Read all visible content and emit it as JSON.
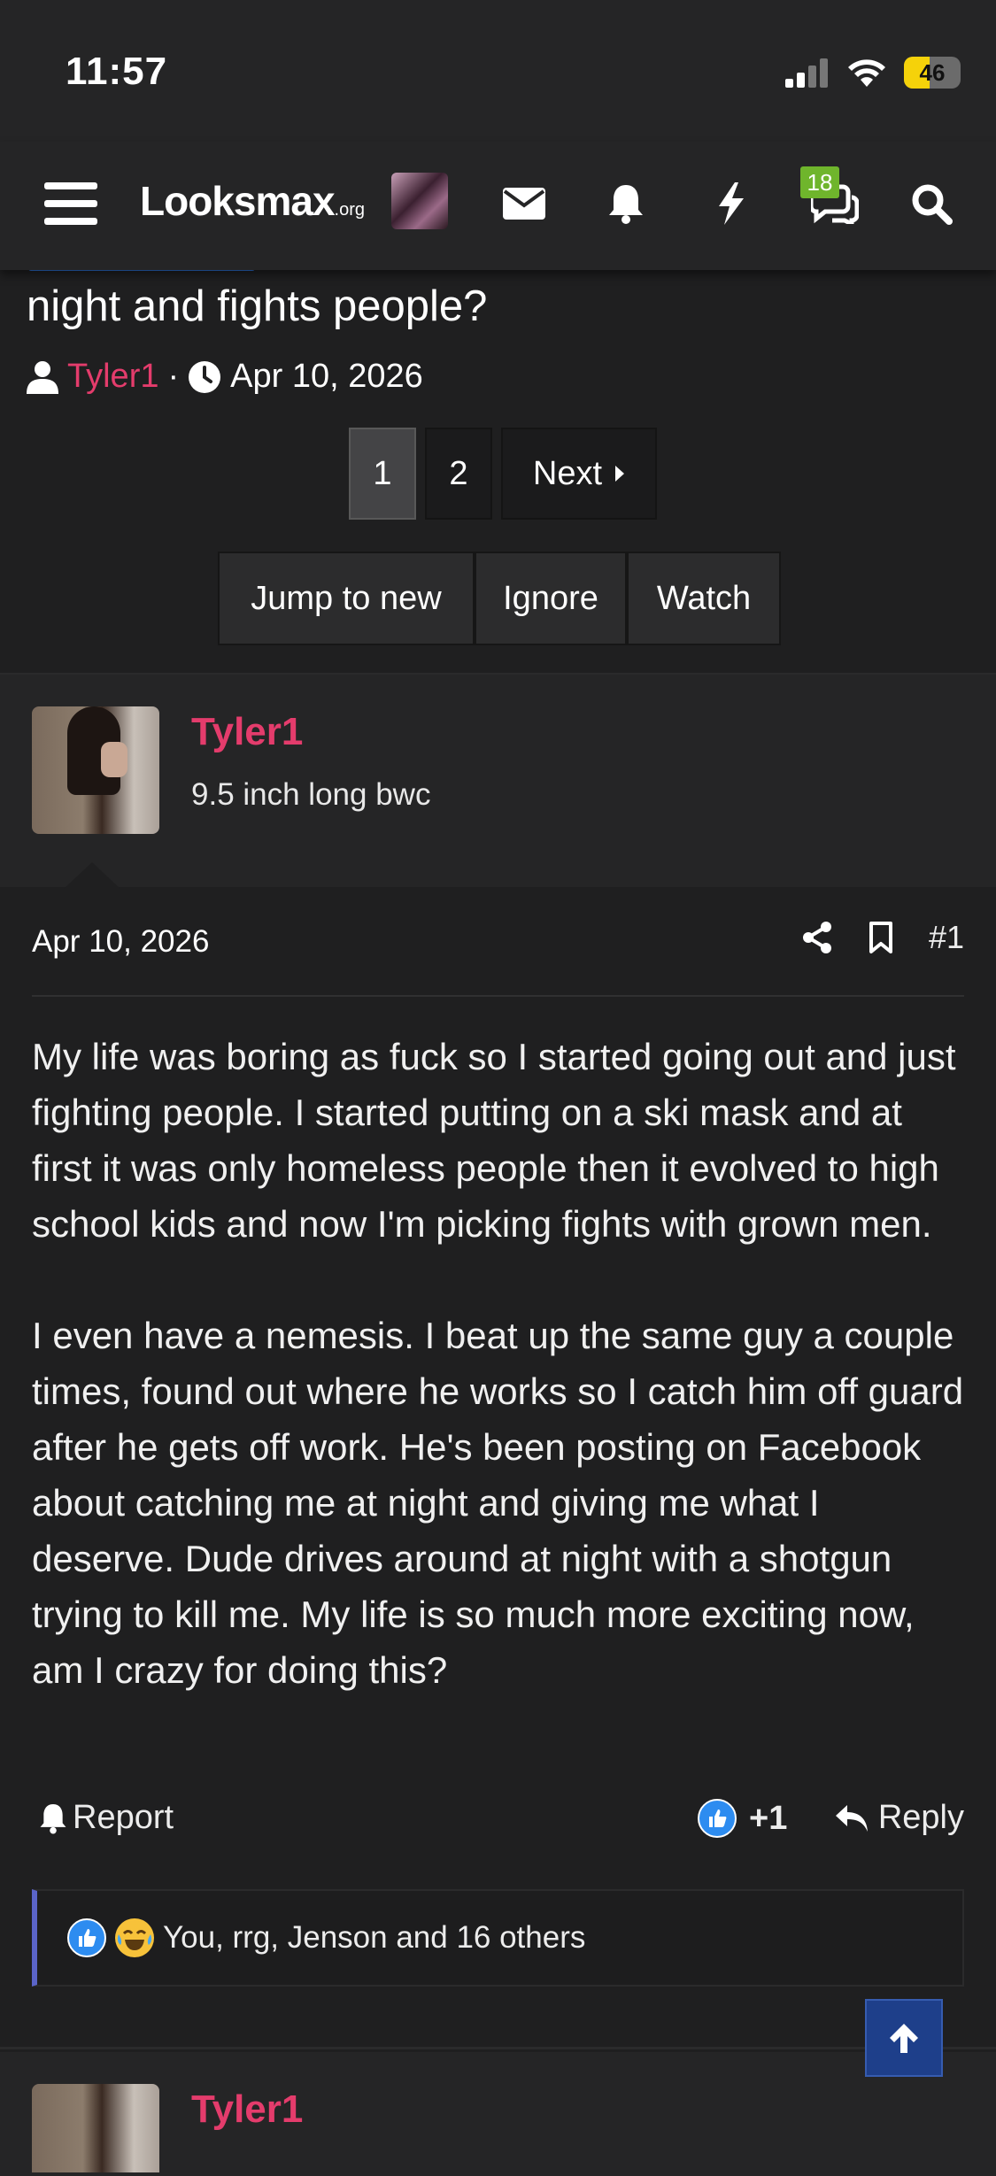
{
  "status_bar": {
    "time": "11:57",
    "battery": "46"
  },
  "nav": {
    "logo": "Looksmax",
    "logo_suffix": ".org",
    "badge_count": "18"
  },
  "thread": {
    "title": "night and fights people?",
    "author": "Tyler1",
    "separator": "·",
    "date": "Apr 10, 2026"
  },
  "pagination": {
    "pages": [
      "1",
      "2"
    ],
    "next": "Next"
  },
  "thread_actions": {
    "jump": "Jump to new",
    "ignore": "Ignore",
    "watch": "Watch"
  },
  "post": {
    "username": "Tyler1",
    "user_title": "9.5 inch long bwc",
    "date": "Apr 10, 2026",
    "number": "#1",
    "paragraphs": [
      "My life was boring as fuck so I started going out and just fighting people. I started putting on a ski mask and at first it was only homeless people then it evolved to high school kids and now I'm picking fights with grown men.",
      "I even have a nemesis. I beat up the same guy a couple times, found out where he works so I catch him off guard after he gets off work. He's been posting on Facebook about catching me at night and giving me what I deserve. Dude drives around at night with a shotgun trying to kill me. My life is so much more exciting now, am I crazy for doing this?"
    ],
    "report_label": "Report",
    "like_label": "+1",
    "reply_label": "Reply",
    "reactions_text": "You, rrg, Jenson and 16 others"
  },
  "next_post": {
    "username": "Tyler1"
  },
  "colors": {
    "accent": "#e43c6c",
    "badge": "#6fb52c",
    "scroll_button": "#1e3f8a"
  }
}
